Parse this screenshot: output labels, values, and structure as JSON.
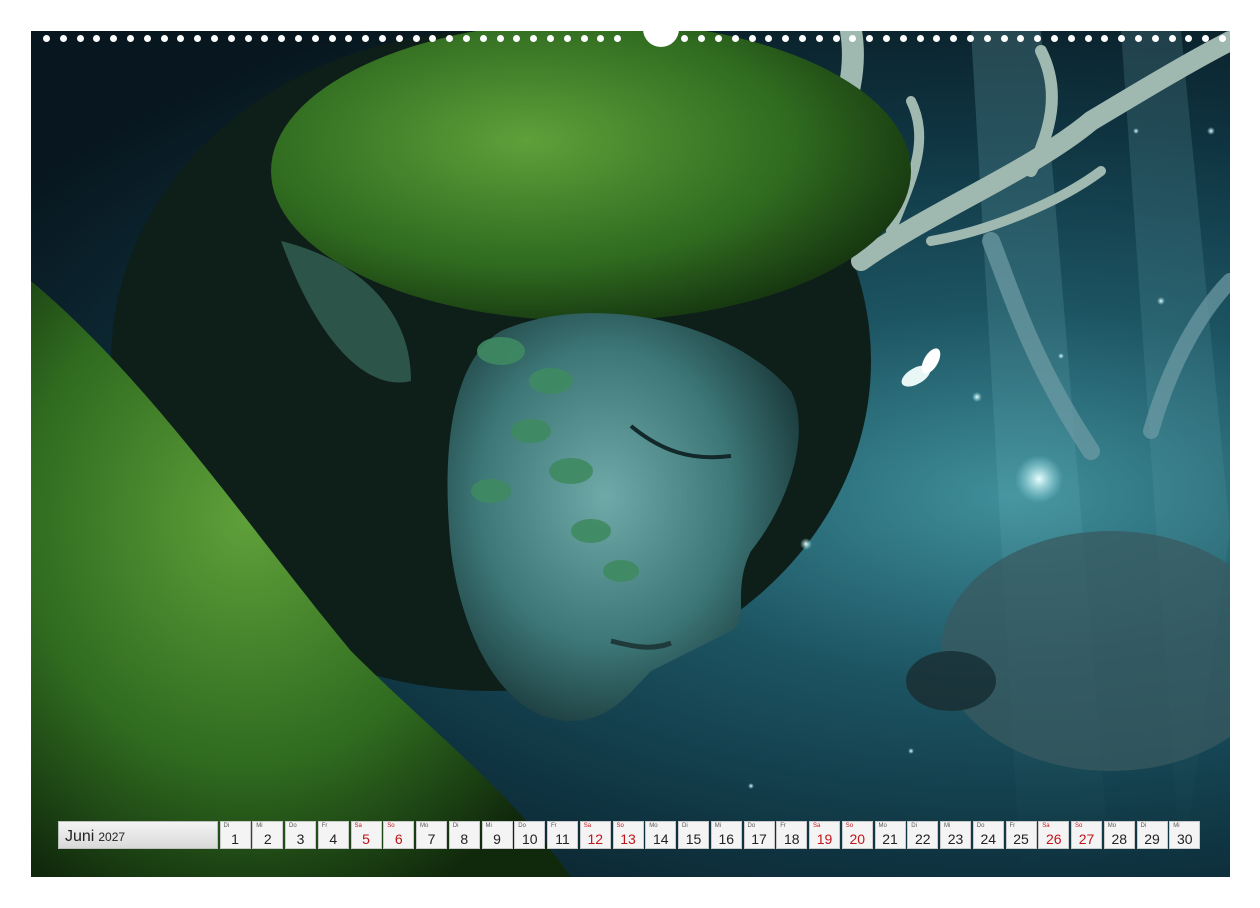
{
  "calendar": {
    "month": "Juni",
    "year": "2027",
    "days": [
      {
        "wd": "Di",
        "num": "1",
        "weekend": false
      },
      {
        "wd": "Mi",
        "num": "2",
        "weekend": false
      },
      {
        "wd": "Do",
        "num": "3",
        "weekend": false
      },
      {
        "wd": "Fr",
        "num": "4",
        "weekend": false
      },
      {
        "wd": "Sa",
        "num": "5",
        "weekend": true
      },
      {
        "wd": "So",
        "num": "6",
        "weekend": true
      },
      {
        "wd": "Mo",
        "num": "7",
        "weekend": false
      },
      {
        "wd": "Di",
        "num": "8",
        "weekend": false
      },
      {
        "wd": "Mi",
        "num": "9",
        "weekend": false
      },
      {
        "wd": "Do",
        "num": "10",
        "weekend": false
      },
      {
        "wd": "Fr",
        "num": "11",
        "weekend": false
      },
      {
        "wd": "Sa",
        "num": "12",
        "weekend": true
      },
      {
        "wd": "So",
        "num": "13",
        "weekend": true
      },
      {
        "wd": "Mo",
        "num": "14",
        "weekend": false
      },
      {
        "wd": "Di",
        "num": "15",
        "weekend": false
      },
      {
        "wd": "Mi",
        "num": "16",
        "weekend": false
      },
      {
        "wd": "Do",
        "num": "17",
        "weekend": false
      },
      {
        "wd": "Fr",
        "num": "18",
        "weekend": false
      },
      {
        "wd": "Sa",
        "num": "19",
        "weekend": true
      },
      {
        "wd": "So",
        "num": "20",
        "weekend": true
      },
      {
        "wd": "Mo",
        "num": "21",
        "weekend": false
      },
      {
        "wd": "Di",
        "num": "22",
        "weekend": false
      },
      {
        "wd": "Mi",
        "num": "23",
        "weekend": false
      },
      {
        "wd": "Do",
        "num": "24",
        "weekend": false
      },
      {
        "wd": "Fr",
        "num": "25",
        "weekend": false
      },
      {
        "wd": "Sa",
        "num": "26",
        "weekend": true
      },
      {
        "wd": "So",
        "num": "27",
        "weekend": true
      },
      {
        "wd": "Mo",
        "num": "28",
        "weekend": false
      },
      {
        "wd": "Di",
        "num": "29",
        "weekend": false
      },
      {
        "wd": "Mi",
        "num": "30",
        "weekend": false
      }
    ]
  },
  "colors": {
    "weekend": "#c0151b",
    "cell_bg": "#f4f4f4",
    "photo_teal": "#3f8f9a",
    "moss_green": "#3f7a2a"
  },
  "photo": {
    "subject_icons": [
      "forest-spirit-face-illustration",
      "antlers",
      "moth",
      "deer"
    ]
  }
}
